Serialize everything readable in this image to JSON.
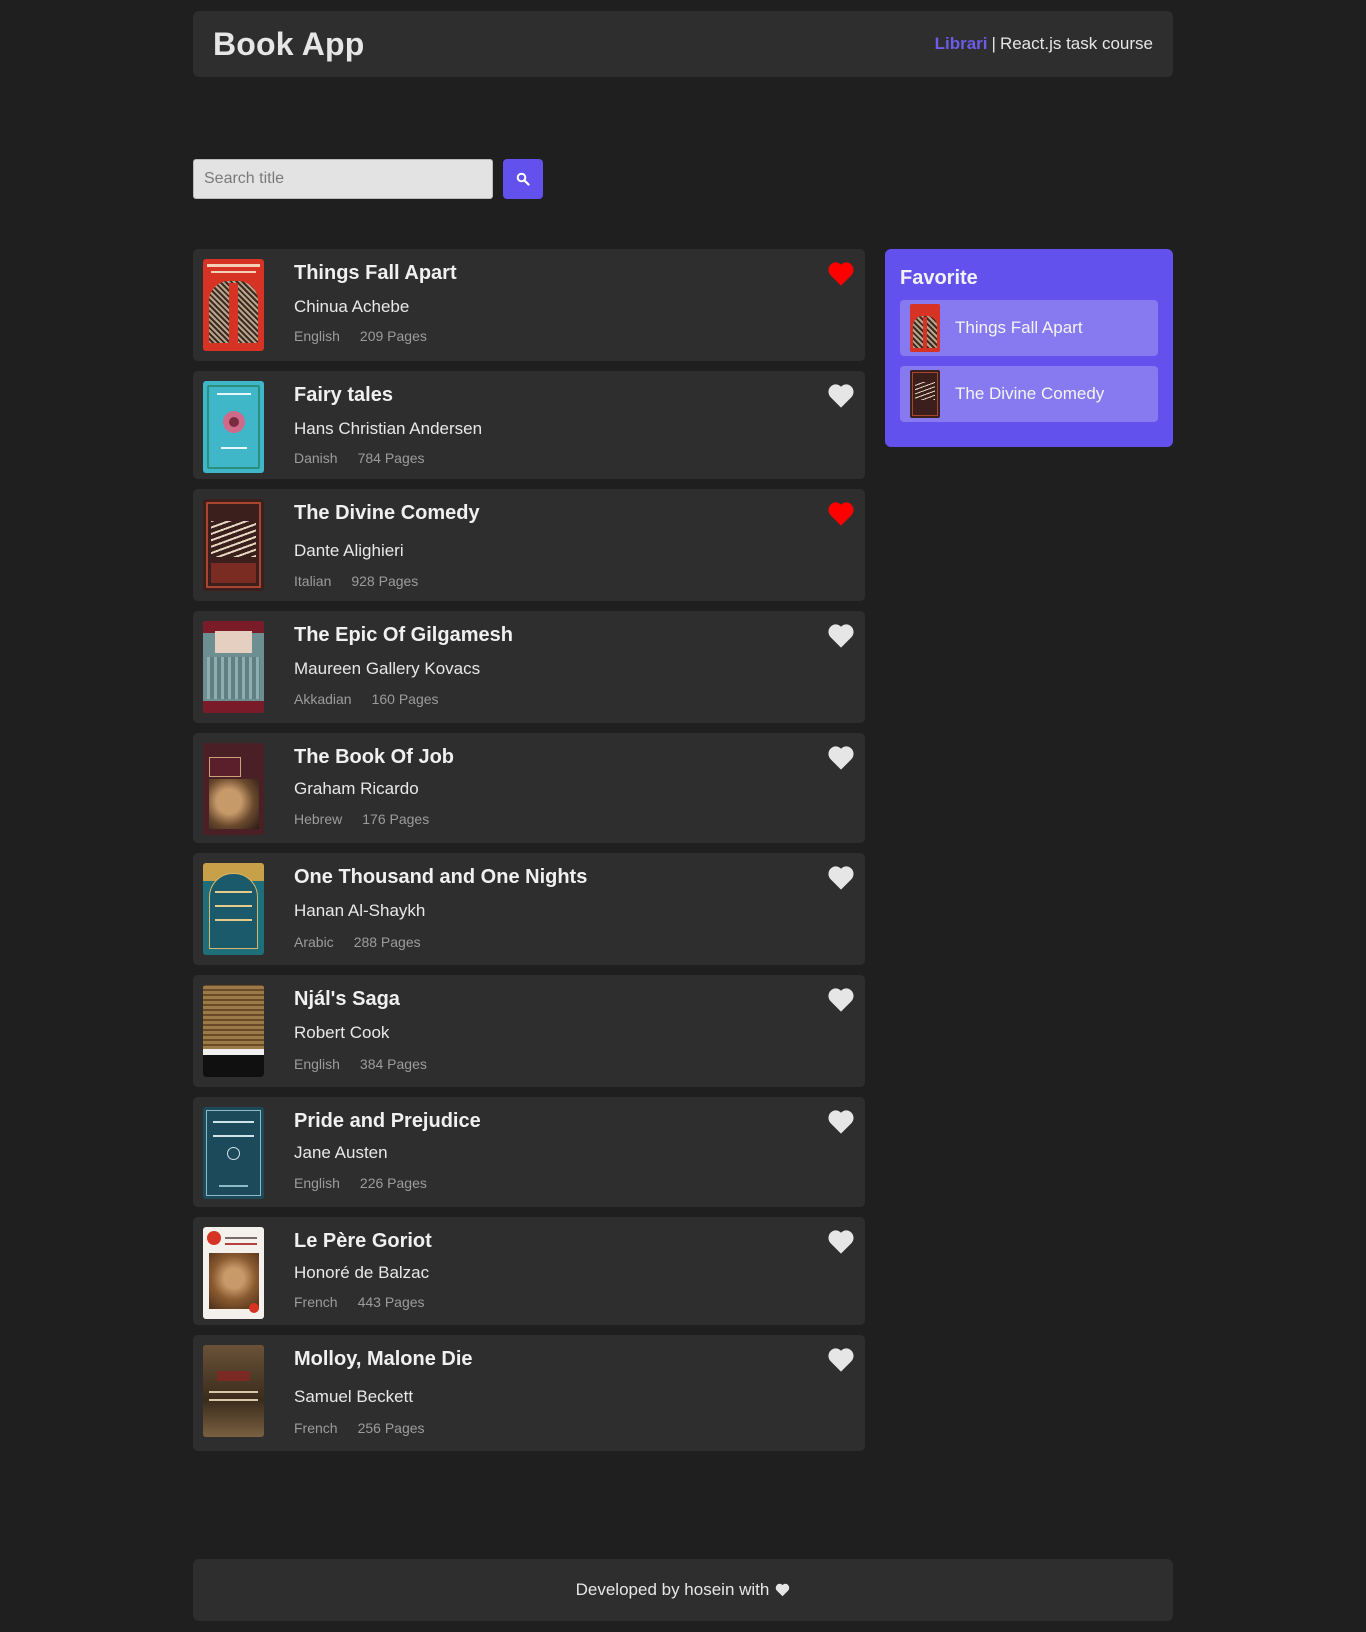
{
  "header": {
    "title": "Book App",
    "brand": "Librari",
    "separator": "|",
    "subtitle": "React.js task course"
  },
  "search": {
    "placeholder": "Search title",
    "value": "",
    "button_icon": "search-icon"
  },
  "books": [
    {
      "title": "Things Fall Apart",
      "author": "Chinua Achebe",
      "language": "English",
      "pages": "209 Pages",
      "favorite": true
    },
    {
      "title": "Fairy tales",
      "author": "Hans Christian Andersen",
      "language": "Danish",
      "pages": "784 Pages",
      "favorite": false
    },
    {
      "title": "The Divine Comedy",
      "author": "Dante Alighieri",
      "language": "Italian",
      "pages": "928 Pages",
      "favorite": true
    },
    {
      "title": "The Epic Of Gilgamesh",
      "author": "Maureen Gallery Kovacs",
      "language": "Akkadian",
      "pages": "160 Pages",
      "favorite": false
    },
    {
      "title": "The Book Of Job",
      "author": "Graham Ricardo",
      "language": "Hebrew",
      "pages": "176 Pages",
      "favorite": false
    },
    {
      "title": "One Thousand and One Nights",
      "author": "Hanan Al-Shaykh",
      "language": "Arabic",
      "pages": "288 Pages",
      "favorite": false
    },
    {
      "title": "Njál's Saga",
      "author": "Robert Cook",
      "language": "English",
      "pages": "384 Pages",
      "favorite": false
    },
    {
      "title": "Pride and Prejudice",
      "author": "Jane Austen",
      "language": "English",
      "pages": "226 Pages",
      "favorite": false
    },
    {
      "title": "Le Père Goriot",
      "author": "Honoré de Balzac",
      "language": "French",
      "pages": "443 Pages",
      "favorite": false
    },
    {
      "title": "Molloy, Malone Die",
      "author": "Samuel Beckett",
      "language": "French",
      "pages": "256 Pages",
      "favorite": false
    }
  ],
  "favorites": {
    "title": "Favorite",
    "items": [
      {
        "title": "Things Fall Apart"
      },
      {
        "title": "The Divine Comedy"
      }
    ]
  },
  "footer": {
    "text": "Developed by hosein with",
    "icon": "heart-icon"
  },
  "colors": {
    "accent": "#6351ed",
    "brand": "#6c5ce7",
    "heart_active": "#ff0000",
    "heart_inactive": "#e6e6e6",
    "card": "#2e2e2e",
    "background": "#1f1f1f"
  }
}
